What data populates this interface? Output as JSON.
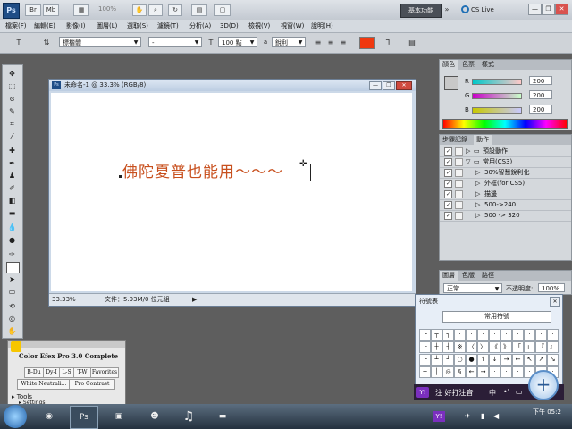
{
  "appbar": {
    "logo": "Ps",
    "zoom": "100%",
    "workspace_label": "基本功能",
    "cs_live_label": "CS Live",
    "window_controls": [
      "—",
      "❐",
      "✕"
    ]
  },
  "menu": [
    "檔案(F)",
    "編輯(E)",
    "影像(I)",
    "圖層(L)",
    "選取(S)",
    "濾鏡(T)",
    "分析(A)",
    "3D(D)",
    "檢視(V)",
    "視窗(W)",
    "說明(H)"
  ],
  "options": {
    "font_family": "標楷體",
    "font_style": "-",
    "font_size": "100 點",
    "antialias_label": "a",
    "antialias_value": "銳利",
    "tt_label": "T"
  },
  "colors": {
    "text_color": "#f0380f",
    "canvas_text": "#c8501e",
    "accent": "#1f4d86"
  },
  "document": {
    "title": "未命名-1 @ 33.3% (RGB/8)",
    "canvas_text": "佛陀夏普也能用～～～",
    "zoom": "33.33%",
    "file_info": "文件：5.93M/0 位元組"
  },
  "color_panel": {
    "tabs": [
      "顏色",
      "色票",
      "樣式"
    ],
    "r": "200",
    "g": "200",
    "b": "200"
  },
  "actions_panel": {
    "tabs": [
      "步驟記錄",
      "動作"
    ],
    "rows": [
      {
        "label": "預設動作",
        "level": 0,
        "folder": true
      },
      {
        "label": "常用(CS3)",
        "level": 0,
        "folder": true
      },
      {
        "label": "30%智慧銳利化",
        "level": 1
      },
      {
        "label": "外框(for CS5)",
        "level": 1
      },
      {
        "label": "描邊",
        "level": 1
      },
      {
        "label": "500->240",
        "level": 1
      },
      {
        "label": "500 -> 320",
        "level": 1
      }
    ]
  },
  "layers_panel": {
    "tabs": [
      "圖層",
      "色版",
      "路徑"
    ],
    "blend_mode": "正常",
    "opacity_label": "不透明度:",
    "opacity": "100%"
  },
  "symbol_window": {
    "title": "符號表",
    "category": "常用符號",
    "symbols": [
      "┌",
      "┬",
      "┐",
      "·",
      "·",
      "·",
      "·",
      "·",
      "·",
      "·",
      "·",
      "·",
      "├",
      "┼",
      "┤",
      "※",
      "〈",
      "〉",
      "《",
      "》",
      "「",
      "」",
      "『",
      "』",
      "└",
      "┴",
      "┘",
      "○",
      "●",
      "↑",
      "↓",
      "→",
      "←",
      "↖",
      "↗",
      "↘",
      "─",
      "│",
      "◎",
      "§",
      "←",
      "→",
      "·",
      "·",
      "·",
      "·",
      "·",
      "·"
    ]
  },
  "plugin": {
    "title": "Color Efex Pro 3.0 Complete",
    "row1": [
      "B-Du",
      "Dy-I",
      "L-S",
      "T-W",
      "Favorites"
    ],
    "row2": [
      "White Neutrali...",
      "Pro Contrast"
    ],
    "tools_label": "Tools",
    "settings_label": "Settings"
  },
  "ime": {
    "text": "注 好打注音",
    "mode": "中"
  },
  "taskbar": {
    "clock": "下午 05:2"
  }
}
